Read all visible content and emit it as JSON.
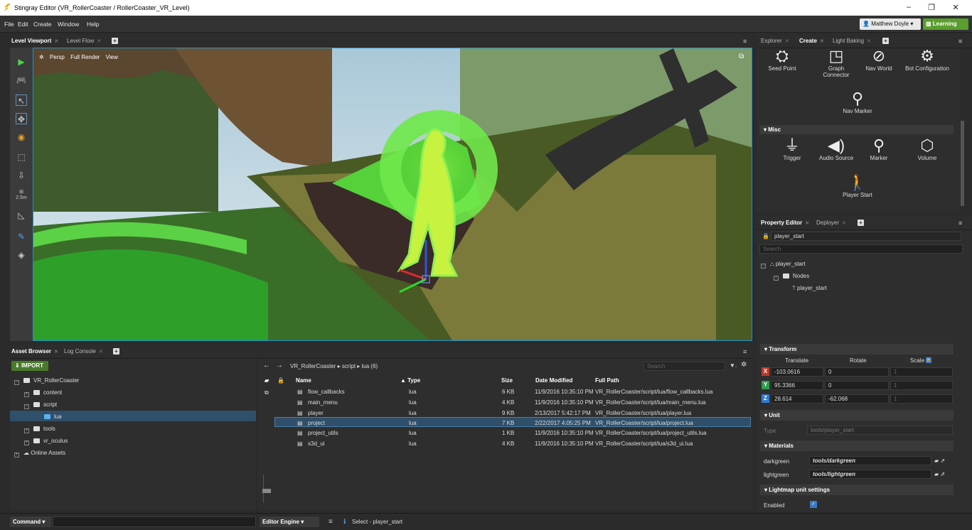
{
  "window": {
    "title": "Stingray Editor (VR_RollerCoaster / RollerCoaster_VR_Level)",
    "minimize": "–",
    "restore": "❐",
    "close": "✕"
  },
  "menu": {
    "items": [
      "File",
      "Edit",
      "Create",
      "Window",
      "Help"
    ],
    "user": "Matthew Doyle ▾",
    "learning": "Learning"
  },
  "viewport_tabs": {
    "tab1": "Level Viewport",
    "tab2": "Level Flow"
  },
  "viewport": {
    "view_mode": "Persp",
    "render_mode": "Full Render",
    "view_menu": "View",
    "snap_value": "2.5m"
  },
  "explorer_tabs": {
    "tab1": "Explorer",
    "tab2": "Create",
    "tab3": "Light Baking"
  },
  "create": {
    "items_top": [
      "Seed Point",
      "Graph Connector",
      "Nav World",
      "Bot Configuration"
    ],
    "nav_marker": "Nav Marker",
    "misc_header": "Misc",
    "misc_items": [
      "Trigger",
      "Audio Source",
      "Marker",
      "Volume"
    ],
    "player_start": "Player Start"
  },
  "property_tabs": {
    "tab1": "Property Editor",
    "tab2": "Deployer"
  },
  "property": {
    "name_value": "player_start",
    "search_placeholder": "Search",
    "tree": {
      "root": "player_start",
      "nodes": "Nodes",
      "leaf": "player_start"
    }
  },
  "transform": {
    "header": "Transform",
    "col_translate": "Translate",
    "col_rotate": "Rotate",
    "col_scale": "Scale",
    "x": "-103.0616",
    "y": "95.3366",
    "z": "28.614",
    "rx": "0",
    "ry": "0",
    "rz": "-62.068",
    "sx": "1",
    "sy": "1",
    "sz": "1",
    "colors": {
      "x": "#c0392b",
      "y": "#2e9e4f",
      "z": "#2f7bd1"
    }
  },
  "unit": {
    "header": "Unit",
    "type_label": "Type",
    "type_value": "tools/player_start"
  },
  "materials": {
    "header": "Materials",
    "rows": [
      {
        "name": "darkgreen",
        "value": "tools/darkgreen"
      },
      {
        "name": "lightgreen",
        "value": "tools/lightgreen"
      }
    ]
  },
  "lightmap": {
    "header": "Lightmap unit settings",
    "enabled_label": "Enabled"
  },
  "asset_tabs": {
    "tab1": "Asset Browser",
    "tab2": "Log Console"
  },
  "asset": {
    "import": "IMPORT",
    "breadcrumb": "VR_RollerCoaster ▸ script ▸ lua (6)",
    "search_placeholder": "Search",
    "tree": {
      "root": "VR_RollerCoaster",
      "content": "content",
      "script": "script",
      "lua": "lua",
      "tools": "tools",
      "vr_oculus": "vr_oculus",
      "online": "Online Assets"
    },
    "columns": {
      "name": "Name",
      "type": "▲ Type",
      "size": "Size",
      "modified": "Date Modified",
      "path": "Full Path"
    },
    "files": [
      {
        "name": "flow_callbacks",
        "type": "lua",
        "size": "6 KB",
        "date": "11/9/2016 10:35:10 PM",
        "path": "VR_RollerCoaster/script/lua/flow_callbacks.lua"
      },
      {
        "name": "main_menu",
        "type": "lua",
        "size": "4 KB",
        "date": "11/9/2016 10:35:10 PM",
        "path": "VR_RollerCoaster/script/lua/main_menu.lua"
      },
      {
        "name": "player",
        "type": "lua",
        "size": "9 KB",
        "date": "2/13/2017 5:42:17 PM",
        "path": "VR_RollerCoaster/script/lua/player.lua"
      },
      {
        "name": "project",
        "type": "lua",
        "size": "7 KB",
        "date": "2/22/2017 4:05:25 PM",
        "path": "VR_RollerCoaster/script/lua/project.lua"
      },
      {
        "name": "project_utils",
        "type": "lua",
        "size": "1 KB",
        "date": "11/9/2016 10:35:10 PM",
        "path": "VR_RollerCoaster/script/lua/project_utils.lua"
      },
      {
        "name": "s3d_ui",
        "type": "lua",
        "size": "4 KB",
        "date": "11/9/2016 10:35:10 PM",
        "path": "VR_RollerCoaster/script/lua/s3d_ui.lua"
      }
    ]
  },
  "status": {
    "command": "Command",
    "engine": "Editor Engine",
    "message": "Select - player_start"
  }
}
